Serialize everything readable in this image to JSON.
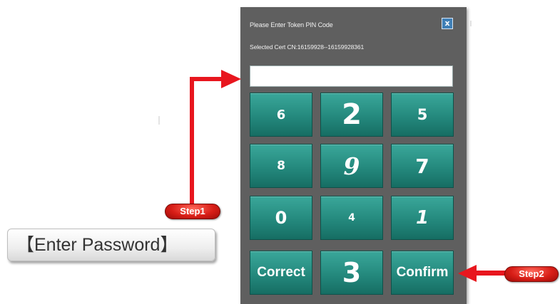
{
  "dialog": {
    "title": "Please Enter Token PIN Code",
    "cert_line": "Selected Cert CN:16159928--16159928361",
    "close_label": "x",
    "pin_value": ""
  },
  "keypad": {
    "rows": [
      [
        "6",
        "2",
        "5"
      ],
      [
        "8",
        "9",
        "7"
      ],
      [
        "0",
        "4",
        "1"
      ],
      [
        "Correct",
        "3",
        "Confirm"
      ]
    ]
  },
  "callouts": {
    "step1": "Step1",
    "step2": "Step2",
    "label": "【Enter Password】",
    "line_color": "#e8161e"
  }
}
